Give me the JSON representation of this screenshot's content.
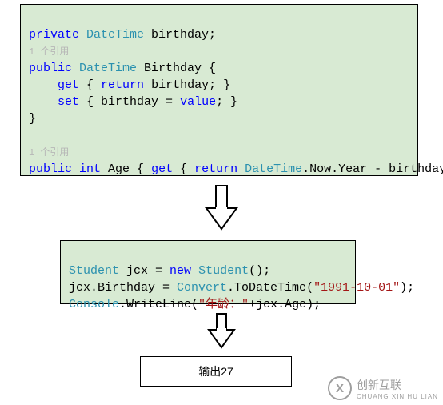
{
  "box1": {
    "line1": {
      "kw1": "private",
      "type": "DateTime",
      "rest": " birthday;"
    },
    "ref1": "1 个引用",
    "line2": {
      "kw1": "public",
      "type": "DateTime",
      "rest": " Birthday {"
    },
    "line3": {
      "indent": "    ",
      "kw1": "get",
      "rest1": " { ",
      "kw2": "return",
      "rest2": " birthday; }"
    },
    "line4": {
      "indent": "    ",
      "kw1": "set",
      "rest1": " { birthday = ",
      "kw2": "value",
      "rest2": "; }"
    },
    "line5": "}",
    "ref2": "1 个引用",
    "line6": {
      "kw1": "public",
      "kw2": "int",
      "rest1": " Age { ",
      "kw3": "get",
      "rest2": " { ",
      "kw4": "return",
      "type1": "DateTime",
      "rest3": ".Now.Year - birthday.Year; } }"
    }
  },
  "box2": {
    "line1": {
      "type1": "Student",
      "rest1": " jcx = ",
      "kw1": "new",
      "type2": "Student",
      "rest2": "();"
    },
    "line2": {
      "rest1": "jcx.Birthday = ",
      "type1": "Convert",
      "rest2": ".ToDateTime(",
      "str1": "\"1991-10-01\"",
      "rest3": ");"
    },
    "line3": {
      "type1": "Console",
      "rest1": ".WriteLine(",
      "str1": "\"年龄：\"",
      "rest2": "+jcx.Age);"
    }
  },
  "box3": {
    "text": "输出27"
  },
  "watermark": {
    "logo": "X",
    "text": "创新互联",
    "sub": "CHUANG XIN HU LIAN"
  }
}
